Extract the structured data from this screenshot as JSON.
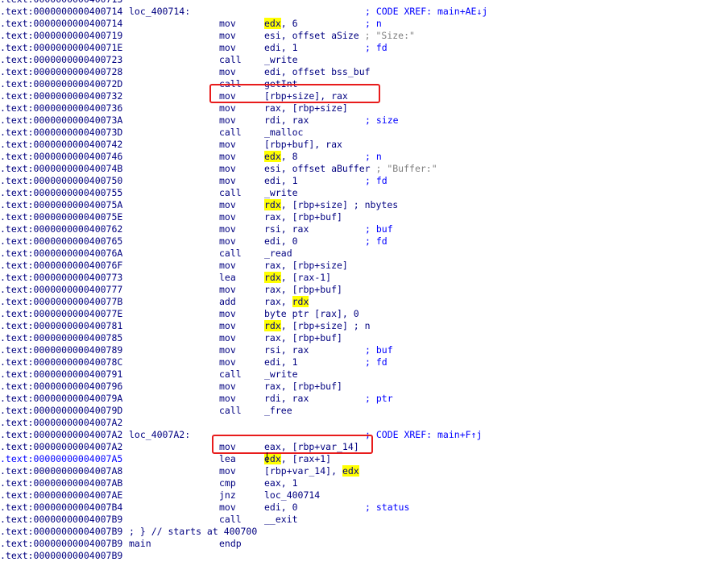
{
  "listing": {
    "highlight_register": "rdx",
    "rows": [
      {
        "address": ".text:0000000000400713",
        "label": "",
        "mnemonic": "",
        "operand": [],
        "comment": "",
        "inline_comment": ""
      },
      {
        "address": ".text:0000000000400714",
        "label": "loc_400714:",
        "mnemonic": "",
        "operand": [],
        "comment": "; CODE XREF: main+AE↓j",
        "inline_comment": ""
      },
      {
        "address": ".text:0000000000400714",
        "label": "",
        "mnemonic": "mov",
        "operand": [
          {
            "t": "edx",
            "h": true
          },
          {
            "t": ", 6"
          }
        ],
        "comment": "; n",
        "inline_comment": ""
      },
      {
        "address": ".text:0000000000400719",
        "label": "",
        "mnemonic": "mov",
        "operand": [
          {
            "t": "esi, offset aSize"
          }
        ],
        "comment": "",
        "inline_comment": "; \"Size:\""
      },
      {
        "address": ".text:000000000040071E",
        "label": "",
        "mnemonic": "mov",
        "operand": [
          {
            "t": "edi, 1"
          }
        ],
        "comment": "; fd",
        "inline_comment": ""
      },
      {
        "address": ".text:0000000000400723",
        "label": "",
        "mnemonic": "call",
        "operand": [
          {
            "t": "_write"
          }
        ],
        "comment": "",
        "inline_comment": ""
      },
      {
        "address": ".text:0000000000400728",
        "label": "",
        "mnemonic": "mov",
        "operand": [
          {
            "t": "edi, offset bss_buf"
          }
        ],
        "comment": "",
        "inline_comment": ""
      },
      {
        "address": ".text:000000000040072D",
        "label": "",
        "mnemonic": "call",
        "operand": [
          {
            "t": "getInt"
          }
        ],
        "comment": "",
        "inline_comment": ""
      },
      {
        "address": ".text:0000000000400732",
        "label": "",
        "mnemonic": "mov",
        "operand": [
          {
            "t": "[rbp+size], rax"
          }
        ],
        "comment": "",
        "inline_comment": ""
      },
      {
        "address": ".text:0000000000400736",
        "label": "",
        "mnemonic": "mov",
        "operand": [
          {
            "t": "rax, [rbp+size]"
          }
        ],
        "comment": "",
        "inline_comment": ""
      },
      {
        "address": ".text:000000000040073A",
        "label": "",
        "mnemonic": "mov",
        "operand": [
          {
            "t": "rdi, rax"
          }
        ],
        "comment": "; size",
        "inline_comment": ""
      },
      {
        "address": ".text:000000000040073D",
        "label": "",
        "mnemonic": "call",
        "operand": [
          {
            "t": "_malloc"
          }
        ],
        "comment": "",
        "inline_comment": ""
      },
      {
        "address": ".text:0000000000400742",
        "label": "",
        "mnemonic": "mov",
        "operand": [
          {
            "t": "[rbp+buf], rax"
          }
        ],
        "comment": "",
        "inline_comment": ""
      },
      {
        "address": ".text:0000000000400746",
        "label": "",
        "mnemonic": "mov",
        "operand": [
          {
            "t": "edx",
            "h": true
          },
          {
            "t": ", 8"
          }
        ],
        "comment": "; n",
        "inline_comment": ""
      },
      {
        "address": ".text:000000000040074B",
        "label": "",
        "mnemonic": "mov",
        "operand": [
          {
            "t": "esi, offset aBuffer"
          }
        ],
        "comment": "",
        "inline_comment": "; \"Buffer:\""
      },
      {
        "address": ".text:0000000000400750",
        "label": "",
        "mnemonic": "mov",
        "operand": [
          {
            "t": "edi, 1"
          }
        ],
        "comment": "; fd",
        "inline_comment": ""
      },
      {
        "address": ".text:0000000000400755",
        "label": "",
        "mnemonic": "call",
        "operand": [
          {
            "t": "_write"
          }
        ],
        "comment": "",
        "inline_comment": ""
      },
      {
        "address": ".text:000000000040075A",
        "label": "",
        "mnemonic": "mov",
        "operand": [
          {
            "t": "rdx",
            "h": true
          },
          {
            "t": ", [rbp+size] ; nbytes"
          }
        ],
        "comment": "",
        "inline_comment": ""
      },
      {
        "address": ".text:000000000040075E",
        "label": "",
        "mnemonic": "mov",
        "operand": [
          {
            "t": "rax, [rbp+buf]"
          }
        ],
        "comment": "",
        "inline_comment": ""
      },
      {
        "address": ".text:0000000000400762",
        "label": "",
        "mnemonic": "mov",
        "operand": [
          {
            "t": "rsi, rax"
          }
        ],
        "comment": "; buf",
        "inline_comment": ""
      },
      {
        "address": ".text:0000000000400765",
        "label": "",
        "mnemonic": "mov",
        "operand": [
          {
            "t": "edi, 0"
          }
        ],
        "comment": "; fd",
        "inline_comment": ""
      },
      {
        "address": ".text:000000000040076A",
        "label": "",
        "mnemonic": "call",
        "operand": [
          {
            "t": "_read"
          }
        ],
        "comment": "",
        "inline_comment": ""
      },
      {
        "address": ".text:000000000040076F",
        "label": "",
        "mnemonic": "mov",
        "operand": [
          {
            "t": "rax, [rbp+size]"
          }
        ],
        "comment": "",
        "inline_comment": ""
      },
      {
        "address": ".text:0000000000400773",
        "label": "",
        "mnemonic": "lea",
        "operand": [
          {
            "t": "rdx",
            "h": true
          },
          {
            "t": ", [rax-1]"
          }
        ],
        "comment": "",
        "inline_comment": ""
      },
      {
        "address": ".text:0000000000400777",
        "label": "",
        "mnemonic": "mov",
        "operand": [
          {
            "t": "rax, [rbp+buf]"
          }
        ],
        "comment": "",
        "inline_comment": ""
      },
      {
        "address": ".text:000000000040077B",
        "label": "",
        "mnemonic": "add",
        "operand": [
          {
            "t": "rax, "
          },
          {
            "t": "rdx",
            "h": true
          }
        ],
        "comment": "",
        "inline_comment": ""
      },
      {
        "address": ".text:000000000040077E",
        "label": "",
        "mnemonic": "mov",
        "operand": [
          {
            "t": "byte ptr [rax], 0"
          }
        ],
        "comment": "",
        "inline_comment": ""
      },
      {
        "address": ".text:0000000000400781",
        "label": "",
        "mnemonic": "mov",
        "operand": [
          {
            "t": "rdx",
            "h": true
          },
          {
            "t": ", [rbp+size] ; n"
          }
        ],
        "comment": "",
        "inline_comment": ""
      },
      {
        "address": ".text:0000000000400785",
        "label": "",
        "mnemonic": "mov",
        "operand": [
          {
            "t": "rax, [rbp+buf]"
          }
        ],
        "comment": "",
        "inline_comment": ""
      },
      {
        "address": ".text:0000000000400789",
        "label": "",
        "mnemonic": "mov",
        "operand": [
          {
            "t": "rsi, rax"
          }
        ],
        "comment": "; buf",
        "inline_comment": ""
      },
      {
        "address": ".text:000000000040078C",
        "label": "",
        "mnemonic": "mov",
        "operand": [
          {
            "t": "edi, 1"
          }
        ],
        "comment": "; fd",
        "inline_comment": ""
      },
      {
        "address": ".text:0000000000400791",
        "label": "",
        "mnemonic": "call",
        "operand": [
          {
            "t": "_write"
          }
        ],
        "comment": "",
        "inline_comment": ""
      },
      {
        "address": ".text:0000000000400796",
        "label": "",
        "mnemonic": "mov",
        "operand": [
          {
            "t": "rax, [rbp+buf]"
          }
        ],
        "comment": "",
        "inline_comment": ""
      },
      {
        "address": ".text:000000000040079A",
        "label": "",
        "mnemonic": "mov",
        "operand": [
          {
            "t": "rdi, rax"
          }
        ],
        "comment": "; ptr",
        "inline_comment": ""
      },
      {
        "address": ".text:000000000040079D",
        "label": "",
        "mnemonic": "call",
        "operand": [
          {
            "t": "_free"
          }
        ],
        "comment": "",
        "inline_comment": ""
      },
      {
        "address": ".text:00000000004007A2",
        "label": "",
        "mnemonic": "",
        "operand": [],
        "comment": "",
        "inline_comment": ""
      },
      {
        "address": ".text:00000000004007A2",
        "label": "loc_4007A2:",
        "mnemonic": "",
        "operand": [],
        "comment": "; CODE XREF: main+F↑j",
        "inline_comment": ""
      },
      {
        "address": ".text:00000000004007A2",
        "label": "",
        "mnemonic": "mov",
        "operand": [
          {
            "t": "eax, [rbp+var_14]"
          }
        ],
        "comment": "",
        "inline_comment": ""
      },
      {
        "address": ".text:00000000004007A5",
        "label": "",
        "mnemonic": "lea",
        "operand": [
          {
            "t": "edx",
            "h": true
          },
          {
            "t": ", [rax+1]"
          }
        ],
        "comment": "",
        "inline_comment": "",
        "current": true
      },
      {
        "address": ".text:00000000004007A8",
        "label": "",
        "mnemonic": "mov",
        "operand": [
          {
            "t": "[rbp+var_14], "
          },
          {
            "t": "edx",
            "h": true
          }
        ],
        "comment": "",
        "inline_comment": ""
      },
      {
        "address": ".text:00000000004007AB",
        "label": "",
        "mnemonic": "cmp",
        "operand": [
          {
            "t": "eax, 1"
          }
        ],
        "comment": "",
        "inline_comment": ""
      },
      {
        "address": ".text:00000000004007AE",
        "label": "",
        "mnemonic": "jnz",
        "operand": [
          {
            "t": "loc_400714"
          }
        ],
        "comment": "",
        "inline_comment": ""
      },
      {
        "address": ".text:00000000004007B4",
        "label": "",
        "mnemonic": "mov",
        "operand": [
          {
            "t": "edi, 0"
          }
        ],
        "comment": "; status",
        "inline_comment": ""
      },
      {
        "address": ".text:00000000004007B9",
        "label": "",
        "mnemonic": "call",
        "operand": [
          {
            "t": "__exit"
          }
        ],
        "comment": "",
        "inline_comment": ""
      },
      {
        "address": ".text:00000000004007B9",
        "label": "; } // starts at 400700",
        "mnemonic": "",
        "operand": [],
        "comment": "",
        "inline_comment": ""
      },
      {
        "address": ".text:00000000004007B9",
        "label": "main",
        "mnemonic": "endp",
        "operand": [],
        "comment": "",
        "inline_comment": ""
      },
      {
        "address": ".text:00000000004007B9",
        "label": "",
        "mnemonic": "",
        "operand": [],
        "comment": "",
        "inline_comment": ""
      }
    ]
  },
  "annotations": {
    "boxed_instructions": [
      "mov [rbp+size], rax",
      "mov eax, [rbp+var_14]"
    ],
    "box_color": "#e81c1c"
  },
  "colors": {
    "text": "#000080",
    "comment": "#0000ff",
    "register_highlight": "#ffff00",
    "background": "#ffffff"
  }
}
